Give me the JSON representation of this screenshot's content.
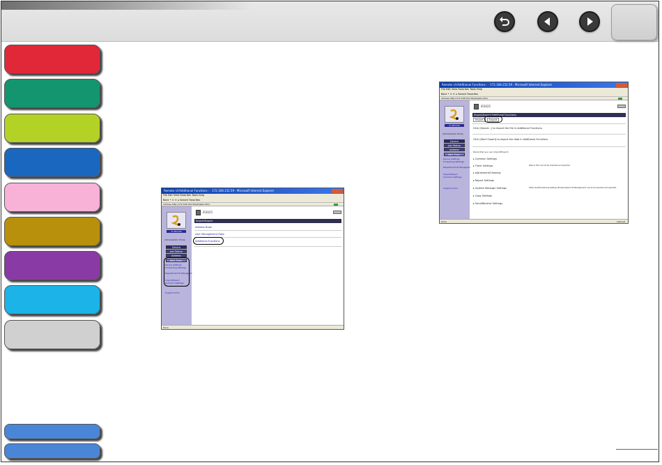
{
  "topbar": {
    "nav": [
      {
        "name": "back-button",
        "icon": "return-arrow-icon"
      },
      {
        "name": "previous-page-button",
        "icon": "triangle-left-icon"
      },
      {
        "name": "next-page-button",
        "icon": "triangle-right-icon"
      }
    ]
  },
  "sidebar": {
    "tabs": [
      {
        "name": "tab-red",
        "color": "#e02838"
      },
      {
        "name": "tab-green",
        "color": "#13956f"
      },
      {
        "name": "tab-lime",
        "color": "#b3d226"
      },
      {
        "name": "tab-blue",
        "color": "#1a67c0"
      },
      {
        "name": "tab-pink",
        "color": "#f8b2d8"
      },
      {
        "name": "tab-gold",
        "color": "#b8900c"
      },
      {
        "name": "tab-purple",
        "color": "#8a3aa4"
      },
      {
        "name": "tab-cyan",
        "color": "#1bb3e8"
      },
      {
        "name": "tab-gray",
        "color": "#d0d0d0"
      }
    ],
    "bottom_tabs": [
      {
        "name": "tab-bottom-1",
        "color": "#4a86d8"
      },
      {
        "name": "tab-bottom-2",
        "color": "#4a86d8"
      }
    ]
  },
  "window_left": {
    "title": "Remote UI:Additional Functions : - 172.168.152.59 - Microsoft Internet Explorer",
    "menu": "File  Edit  View  Favorites  Tools  Help",
    "toolbar": "Back  •  ⊙  ✕  ⌂  Search  Favorites",
    "address": "Address  http://172.168.152.59/ext/jobs.html",
    "side": {
      "model": "CI SE1234",
      "admin": "Administrator Mode",
      "buttons": [
        "Device",
        "Job Status",
        "Address",
        "Add. Func."
      ],
      "links": [
        "Device Settings",
        "Forwarding Settings",
        "Department ID Management",
        "Import/Export",
        "Common Settings"
      ],
      "support": "Support Links"
    },
    "main": {
      "header": "iR3025",
      "section": "Import/Export",
      "items": [
        "Address Book",
        "User Management Data",
        "Additional Functions"
      ]
    },
    "status": "Done"
  },
  "window_right": {
    "title": "Remote UI:Additional Functions : - 172.168.152.59 - Microsoft Internet Explorer",
    "menu": "File  Edit  View  Favorites  Tools  Help",
    "toolbar": "Back  •  ⊙  ✕  ⌂  Search  Favorites",
    "address": "Address  http://172.168.152.59/ext/jobs.html",
    "side": {
      "model": "CI SE1234",
      "admin": "Administrator Mode",
      "buttons": [
        "Device",
        "Job Status",
        "Address",
        "Add. Func."
      ],
      "links": [
        "Device Settings",
        "Forwarding Settings",
        "Department ID Management",
        "Import/Export",
        "Common Settings"
      ],
      "support": "Support Links"
    },
    "main": {
      "header": "iR3025",
      "section": "Import/Export:Additional Functions",
      "subtabs": [
        "Import",
        "Export"
      ],
      "line1": "Click [Import...] to import the file in Additional Functions.",
      "line2": "Click [Start Export] to export the data in Additional Functions.",
      "note": "Items that you can Import/Export:",
      "items": [
        "Common Settings",
        "Timer Settings",
        "Adjustment/Cleaning",
        "Report Settings",
        "System Manager Settings",
        "Copy Settings",
        "Send/Receive Settings"
      ],
      "item_notes": {
        "timer": "Date & Time cannot be imported and exported.",
        "system": "Other Send/Forwarding Settings (Except System ID Management) cannot be imported and exported."
      }
    },
    "status": "Done",
    "status_right": "Internet"
  }
}
